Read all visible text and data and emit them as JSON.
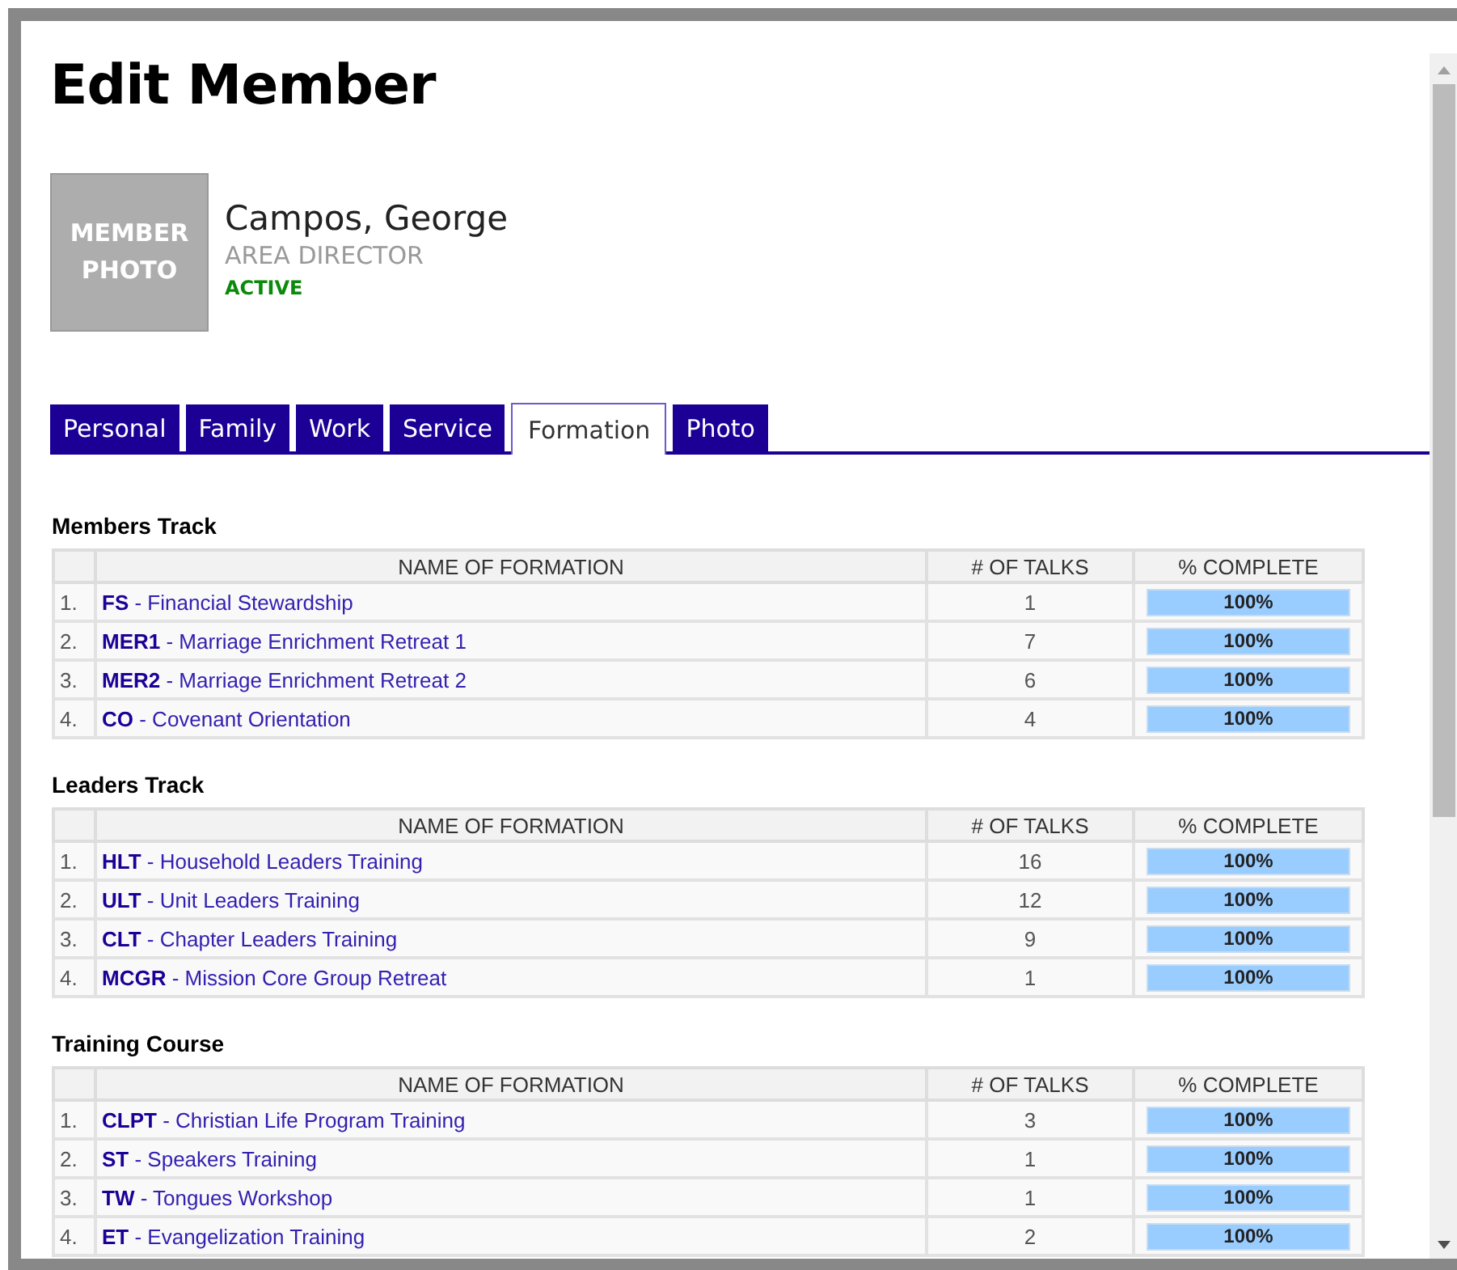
{
  "title": "Edit Member",
  "member": {
    "photo_placeholder": "MEMBER PHOTO",
    "name": "Campos, George",
    "role": "AREA DIRECTOR",
    "status": "ACTIVE"
  },
  "tabs": [
    {
      "label": "Personal",
      "selected": false
    },
    {
      "label": "Family",
      "selected": false
    },
    {
      "label": "Work",
      "selected": false
    },
    {
      "label": "Service",
      "selected": false
    },
    {
      "label": "Formation",
      "selected": true
    },
    {
      "label": "Photo",
      "selected": false
    }
  ],
  "sections": [
    {
      "title": "Members Track",
      "columns": [
        "NAME OF FORMATION",
        "# OF TALKS",
        "% COMPLETE"
      ],
      "rows": [
        {
          "num": "1.",
          "name": "**FS** - Financial Stewardship",
          "talks": "1",
          "level": 1,
          "complete": "100%"
        },
        {
          "num": "2.",
          "name": "**MER1** - Marriage Enrichment Retreat 1",
          "talks": "7",
          "level": 1,
          "complete": "100%"
        },
        {
          "num": "3.",
          "name": "**MER2** - Marriage Enrichment Retreat 2",
          "talks": "6",
          "level": 1,
          "complete": "100%"
        },
        {
          "num": "4.",
          "name": "**CO** - Covenant Orientation",
          "talks": "4",
          "level": 1,
          "complete": "100%"
        }
      ]
    },
    {
      "title": "Leaders Track",
      "columns": [
        "NAME OF FORMATION",
        "# OF TALKS",
        "% COMPLETE"
      ],
      "rows": [
        {
          "num": "1.",
          "name": "**HLT** - Household Leaders Training",
          "talks": "16",
          "level": 1,
          "complete": "100%"
        },
        {
          "num": "2.",
          "name": "**ULT** - Unit Leaders Training",
          "talks": "12",
          "level": 1,
          "complete": "100%"
        },
        {
          "num": "3.",
          "name": "**CLT** - Chapter Leaders Training",
          "talks": "9",
          "level": 1,
          "complete": "100%"
        },
        {
          "num": "4.",
          "name": "**MCGR** - Mission Core Group Retreat",
          "talks": "1",
          "level": 1,
          "complete": "100%"
        }
      ]
    },
    {
      "title": "Training Course",
      "columns": [
        "NAME OF FORMATION",
        "# OF TALKS",
        "% COMPLETE"
      ],
      "rows": [
        {
          "num": "1.",
          "name": "**CLPT** - Christian Life Program Training",
          "talks": "3",
          "level": 1,
          "complete": "100%"
        },
        {
          "num": "2.",
          "name": "**ST** - Speakers Training",
          "talks": "1",
          "level": 1,
          "complete": "100%"
        },
        {
          "num": "3.",
          "name": "**TW** - Tongues Workshop",
          "talks": "1",
          "level": 1,
          "complete": "100%"
        },
        {
          "num": "4.",
          "name": "**ET** - Evangelization Training",
          "talks": "2",
          "level": 1,
          "complete": "100%"
        }
      ]
    }
  ]
}
